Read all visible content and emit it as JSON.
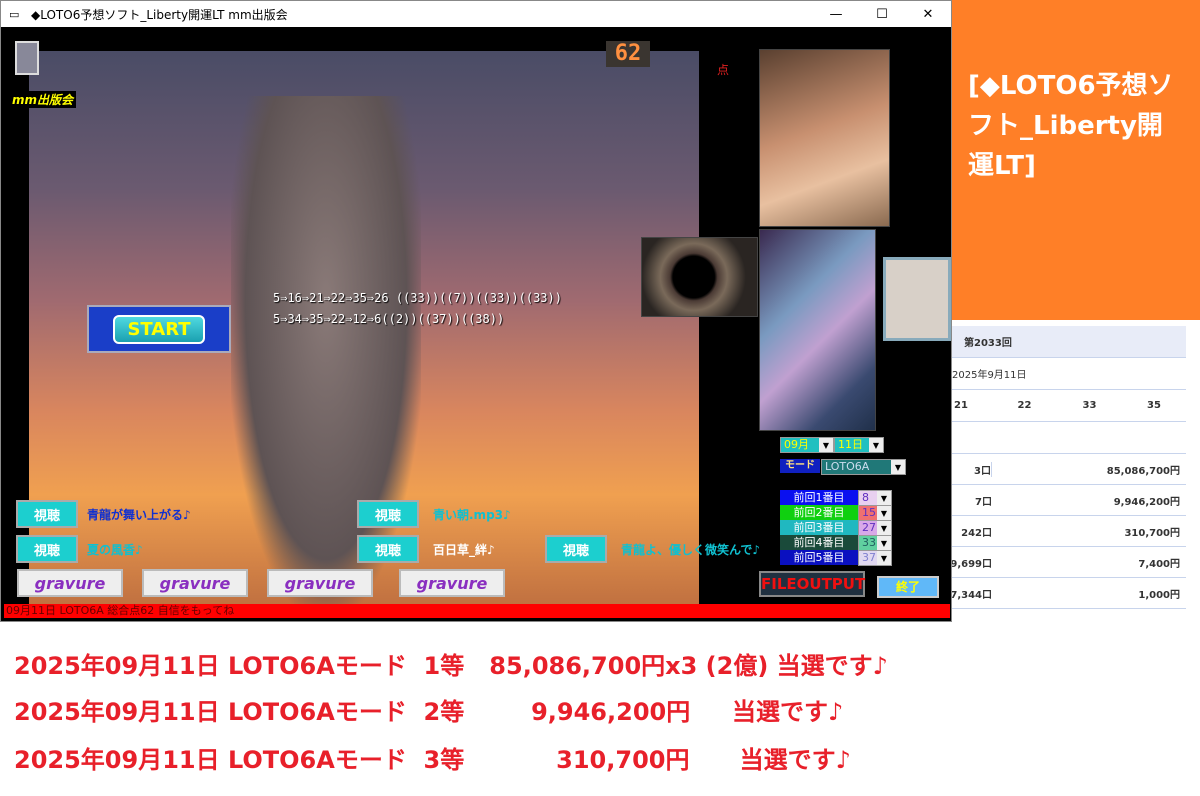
{
  "window": {
    "title": "◆LOTO6予想ソフト_Liberty開運LT  mm出版会",
    "minimize": "—",
    "maximize": "☐",
    "close": "✕"
  },
  "app": {
    "publisher": "mm出版会",
    "score_display": "62",
    "score_unit": "点",
    "prediction_lines": [
      "5⇒16⇒21⇒22⇒35⇒26 ((33))((7))((33))((33))",
      "5⇒34⇒35⇒22⇒12⇒6((2))((37))((38))"
    ],
    "start_label": "START",
    "listen_label": "視聴",
    "songs": [
      "青龍が舞い上がる♪",
      "夏の風香♪",
      "青い朝.mp3♪",
      "百日草_絆♪",
      "青龍よ、優しく微笑んで♪"
    ],
    "gravure_label": "gravure",
    "month": "09月",
    "day": "11日",
    "mode_label": "モード",
    "mode_value": "LOTO6A",
    "previous": [
      {
        "label": "前回1番目",
        "value": "8"
      },
      {
        "label": "前回2番目",
        "value": "15"
      },
      {
        "label": "前回3番目",
        "value": "27"
      },
      {
        "label": "前回4番目",
        "value": "33"
      },
      {
        "label": "前回5番目",
        "value": "37"
      }
    ],
    "fileoutput_label": "FILEOUTPUT",
    "exit_label": "終了",
    "status": "09月11日 LOTO6A  総合点62  自信をもってね"
  },
  "banner": "[◆LOTO6予想ソフト_Liberty開運LT]",
  "results_table": {
    "round": "第2033回",
    "date": "2025年9月11日",
    "numbers": [
      "21",
      "22",
      "33",
      "35"
    ],
    "prizes": [
      {
        "count": "3口",
        "amount": "85,086,700円"
      },
      {
        "count": "7口",
        "amount": "9,946,200円"
      },
      {
        "count": "242口",
        "amount": "310,700円"
      },
      {
        "count": "9,699口",
        "amount": "7,400円"
      },
      {
        "count": "7,344口",
        "amount": "1,000円"
      }
    ]
  },
  "winnings": [
    "2025年09月11日 LOTO6Aモード  1等   85,086,700円x3 (2億) 当選です♪",
    "2025年09月11日 LOTO6Aモード  2等        9,946,200円     当選です♪",
    "2025年09月11日 LOTO6Aモード  3等           310,700円      当選です♪"
  ],
  "colors": {
    "status_bar": "#ff0000",
    "banner": "#ff7f27",
    "winning_text": "#e8202a"
  }
}
